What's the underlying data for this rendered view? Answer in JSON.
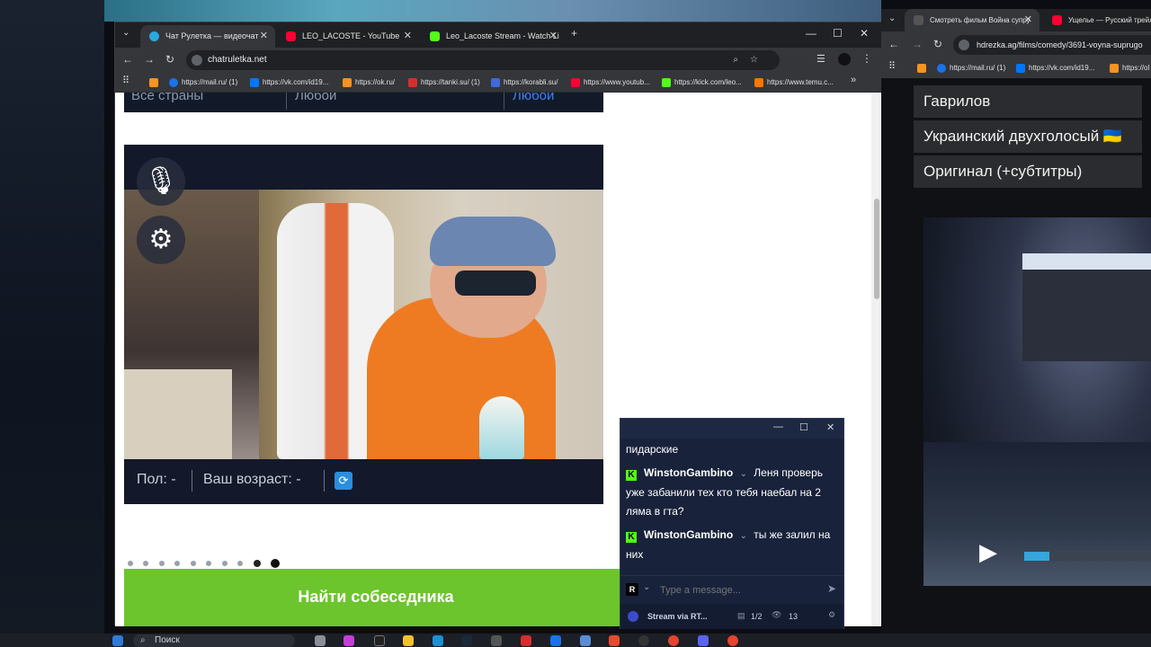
{
  "left_browser": {
    "tabs": [
      {
        "title": "Чат Рулетка — видеочат",
        "active": true
      },
      {
        "title": "LEO_LACOSTE - YouTube",
        "active": false
      },
      {
        "title": "Leo_Lacoste Stream - Watch Li",
        "active": false
      }
    ],
    "new_tab": "+",
    "address": "chatruletka.net",
    "bookmarks": [
      "https://mail.ru/ (1)",
      "https://vk.com/id19...",
      "https://ok.ru/",
      "https://tanki.su/ (1)",
      "https://korabli.su/",
      "https://www.youtub...",
      "https://kick.com/leo...",
      "https://www.temu.c..."
    ]
  },
  "page": {
    "filters": {
      "country": "Все страны",
      "gender": "Любой",
      "age": "Любой"
    },
    "video_footer": {
      "gender": "Пол: -",
      "age": "Ваш возраст: -"
    },
    "find_button": "Найти собеседника",
    "carousel": {
      "count": 10,
      "active_index": 9
    }
  },
  "chat": {
    "messages": [
      {
        "user": "",
        "text": "пидарские"
      },
      {
        "user": "WinstonGambino",
        "text": "Леня проверь уже забанили тех кто тебя наебал на 2 ляма в гта?"
      },
      {
        "user": "WinstonGambino",
        "text": "ты же залил на них"
      }
    ],
    "input_placeholder": "Type a message...",
    "footer_label": "Stream via RT...",
    "page_indicator": "1/2",
    "viewers": "13"
  },
  "right_browser": {
    "tabs": [
      {
        "title": "Смотреть фильм Война супру"
      },
      {
        "title": "Ущелье — Русский трейл"
      }
    ],
    "address": "hdrezka.ag/films/comedy/3691-voyna-suprugo",
    "bookmarks": [
      "https://mail.ru/ (1)",
      "https://vk.com/id19...",
      "https://ol"
    ],
    "dubs": [
      "Гаврилов",
      "Украинский двухголосый 🇺🇦",
      "Оригинал (+субтитры)"
    ],
    "player_progress": 0.2
  },
  "taskbar": {
    "search_placeholder": "Поиск"
  }
}
